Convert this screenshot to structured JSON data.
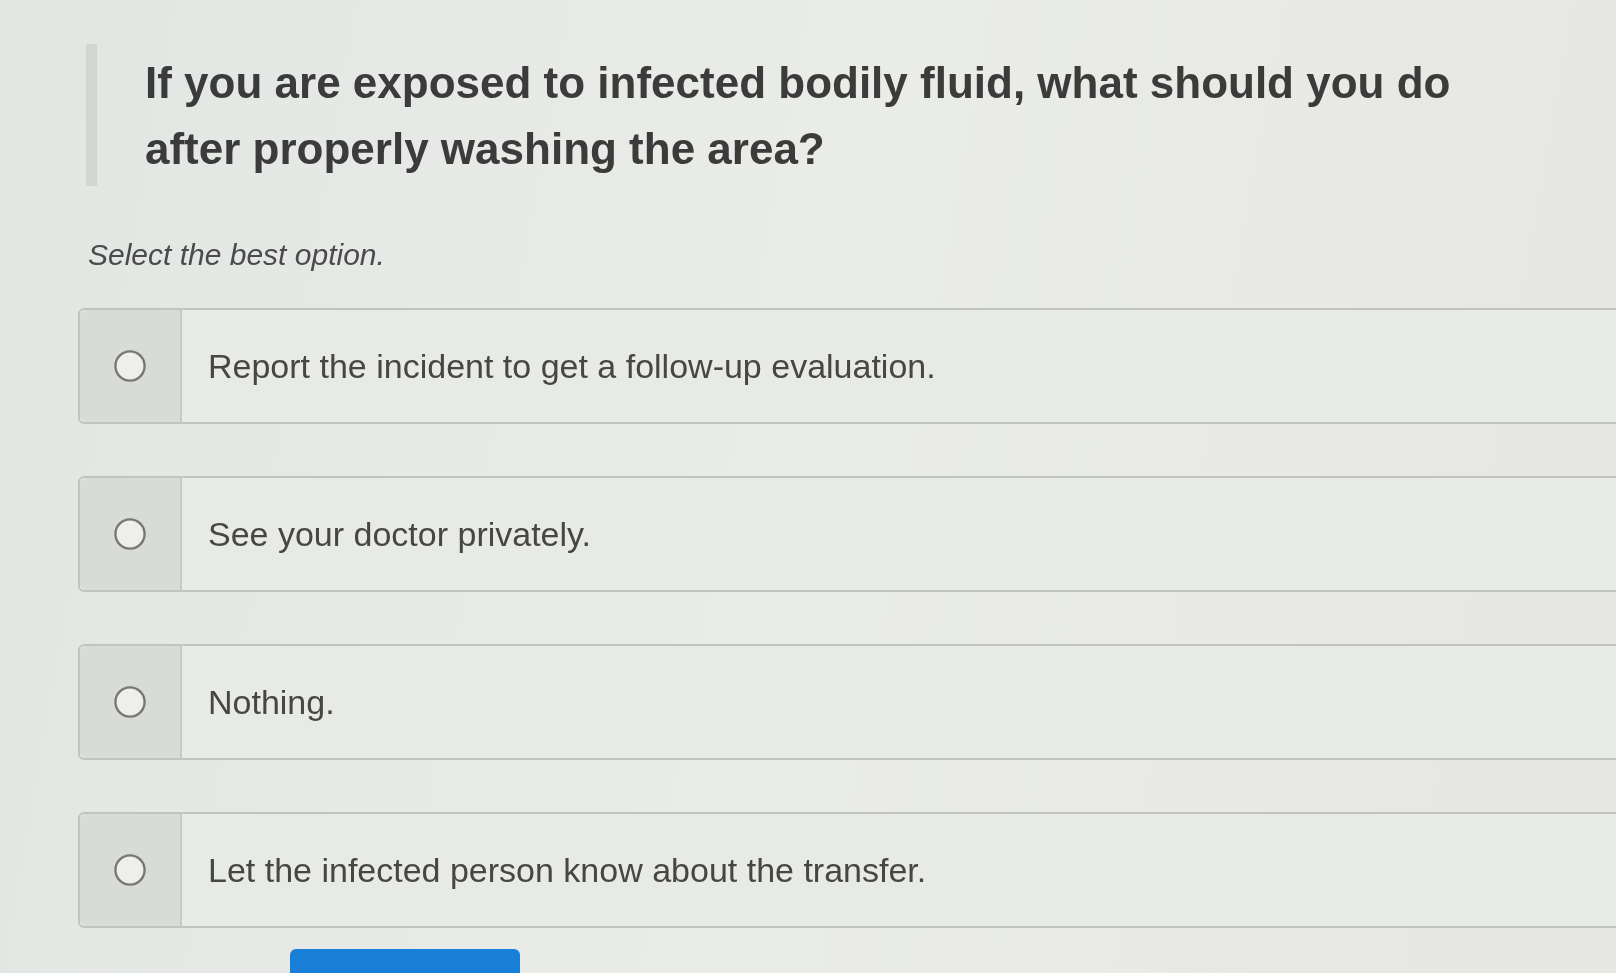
{
  "question": {
    "text": "If you are exposed to infected bodily fluid, what should you do after properly washing the area?"
  },
  "instruction": "Select the best option.",
  "options": [
    {
      "label": "Report the incident to get a follow-up evaluation.",
      "selected": false
    },
    {
      "label": "See your doctor privately.",
      "selected": false
    },
    {
      "label": "Nothing.",
      "selected": false
    },
    {
      "label": "Let the infected person know about the transfer.",
      "selected": false
    }
  ]
}
